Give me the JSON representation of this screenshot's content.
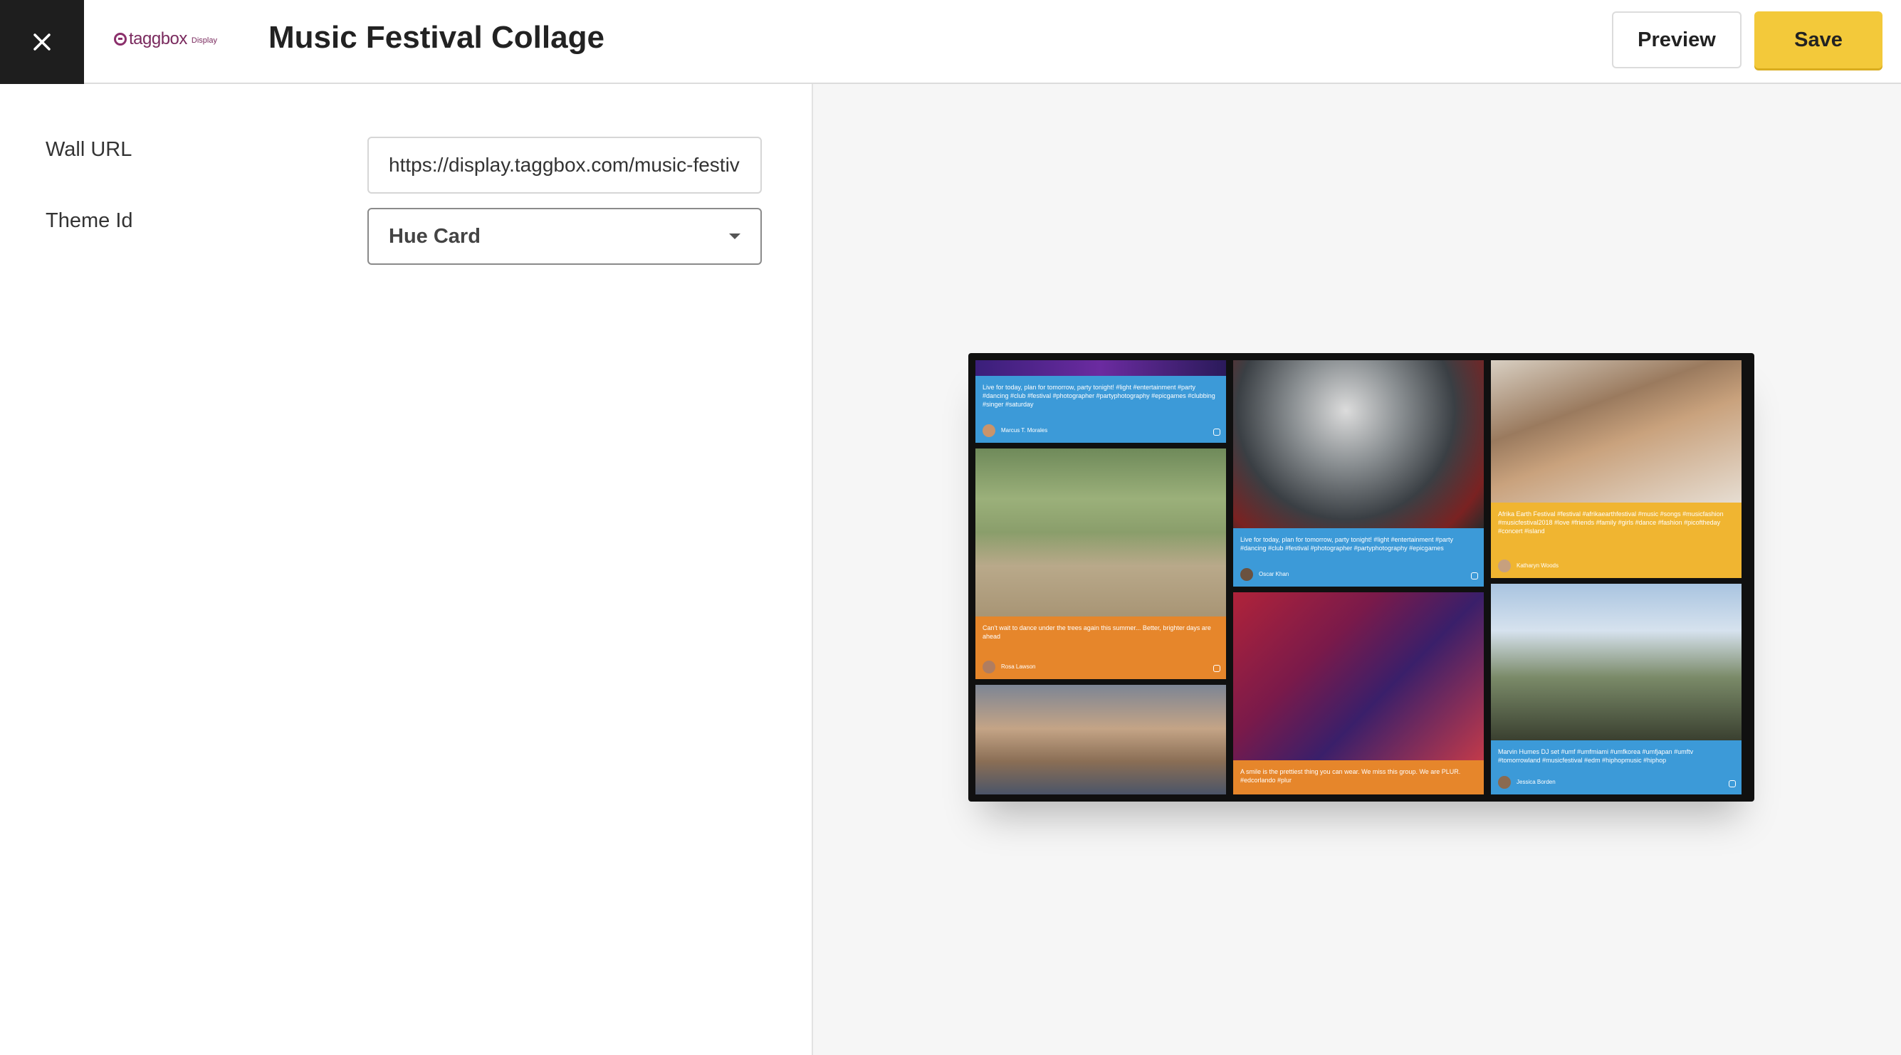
{
  "header": {
    "close_label": "close",
    "logo_text": "taggbox",
    "logo_sub": "Display",
    "title": "Music Festival Collage",
    "preview_label": "Preview",
    "save_label": "Save"
  },
  "form": {
    "wall_url_label": "Wall URL",
    "wall_url_value": "https://display.taggbox.com/music-festival",
    "theme_label": "Theme Id",
    "theme_value": "Hue Card"
  },
  "preview": {
    "cards": [
      {
        "caption": "Live for today, plan for tomorrow, party tonight! #light #entertainment #party #dancing #club #festival #photographer #partyphotography #epicgames #clubbing #singer #saturday",
        "author": "Marcus T. Morales",
        "color": "#3c9ad8"
      },
      {
        "caption": "Can't wait to dance under the trees again this summer... Better, brighter days are ahead",
        "author": "Rosa Lawson",
        "color": "#e6862b"
      },
      {
        "caption": "Live for today, plan for tomorrow, party tonight! #light #entertainment #party #dancing #club #festival #photographer #partyphotography #epicgames",
        "author": "Oscar Khan",
        "color": "#3c9ad8"
      },
      {
        "caption": "A smile is the prettiest thing you can wear. We miss this group. We are PLUR. #edcorlando #plur",
        "author": "",
        "color": "#e6862b"
      },
      {
        "caption": "Afrika Earth Festival #festival #afrikaearthfestival #music #songs #musicfashion #musicfestival2018 #love #friends #family #girls #dance #fashion #picoftheday #concert #island",
        "author": "Katharyn Woods",
        "color": "#f0b531"
      },
      {
        "caption": "Marvin Humes DJ set #umf #umfmiami #umfkorea #umfjapan #umftv #tomorrowland #musicfestival #edm #hiphopmusic #hiphop",
        "author": "Jessica Borden",
        "color": "#3c9ad8"
      }
    ]
  }
}
